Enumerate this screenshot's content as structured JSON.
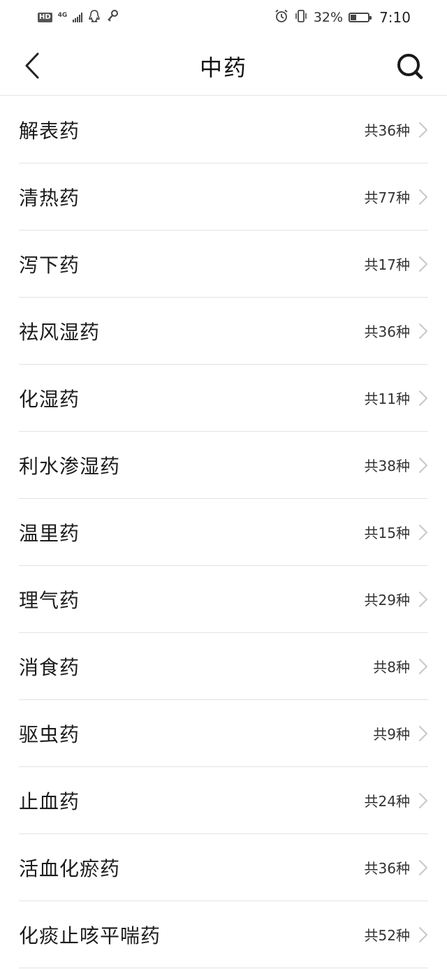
{
  "status_bar": {
    "hd": "HD",
    "network": "4G",
    "battery_text": "32%",
    "battery_level": 0.32,
    "time": "7:10",
    "icons": [
      "hd-icon",
      "signal-icon",
      "qq-icon",
      "key-icon",
      "alarm-icon",
      "vibrate-icon",
      "battery-icon"
    ]
  },
  "header": {
    "title": "中药",
    "back_icon": "chevron-left-icon",
    "search_icon": "search-icon"
  },
  "categories": [
    {
      "name": "解表药",
      "count": "共36种"
    },
    {
      "name": "清热药",
      "count": "共77种"
    },
    {
      "name": "泻下药",
      "count": "共17种"
    },
    {
      "name": "祛风湿药",
      "count": "共36种"
    },
    {
      "name": "化湿药",
      "count": "共11种"
    },
    {
      "name": "利水渗湿药",
      "count": "共38种"
    },
    {
      "name": "温里药",
      "count": "共15种"
    },
    {
      "name": "理气药",
      "count": "共29种"
    },
    {
      "name": "消食药",
      "count": "共8种"
    },
    {
      "name": "驱虫药",
      "count": "共9种"
    },
    {
      "name": "止血药",
      "count": "共24种"
    },
    {
      "name": "活血化瘀药",
      "count": "共36种"
    },
    {
      "name": "化痰止咳平喘药",
      "count": "共52种"
    }
  ],
  "colors": {
    "background": "#ffffff",
    "divider": "#e3e3e3",
    "chevron": "#c8c8c8",
    "text": "#1c1c1c"
  }
}
